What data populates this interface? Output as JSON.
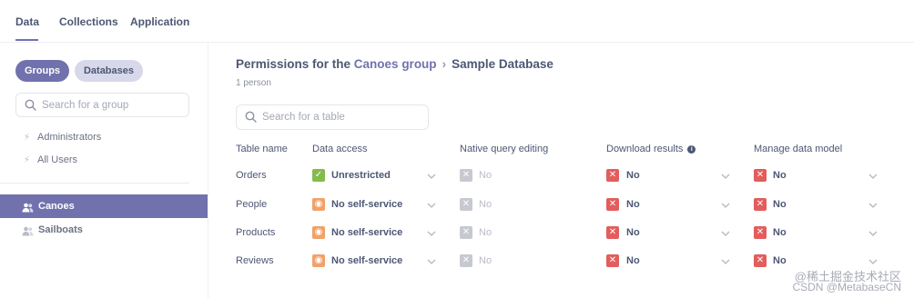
{
  "nav": {
    "tabs": [
      "Data",
      "Collections",
      "Application"
    ]
  },
  "sidebar": {
    "toggle": {
      "groups": "Groups",
      "databases": "Databases"
    },
    "search_placeholder": "Search for a group",
    "default_groups": [
      "Administrators",
      "All Users"
    ],
    "groups": [
      {
        "label": "Canoes",
        "active": true
      },
      {
        "label": "Sailboats",
        "active": false
      }
    ]
  },
  "main": {
    "title_prefix": "Permissions for the ",
    "group_name": "Canoes group",
    "database_name": "Sample Database",
    "subtitle": "1 person",
    "search_placeholder": "Search for a table",
    "columns": [
      "Table name",
      "Data access",
      "Native query editing",
      "Download results",
      "Manage data model"
    ],
    "rows": [
      {
        "table": "Orders",
        "data_access": "Unrestricted",
        "data_access_kind": "check",
        "native": "No",
        "download": "No",
        "model": "No"
      },
      {
        "table": "People",
        "data_access": "No self-service",
        "data_access_kind": "eye",
        "native": "No",
        "download": "No",
        "model": "No"
      },
      {
        "table": "Products",
        "data_access": "No self-service",
        "data_access_kind": "eye",
        "native": "No",
        "download": "No",
        "model": "No"
      },
      {
        "table": "Reviews",
        "data_access": "No self-service",
        "data_access_kind": "eye",
        "native": "No",
        "download": "No",
        "model": "No"
      }
    ]
  },
  "watermark": {
    "line1": "@稀土掘金技术社区",
    "line2": "CSDN @MetabaseCN"
  },
  "colors": {
    "accent": "#7172ad",
    "green": "#84bb4c",
    "orange": "#f0a26a",
    "red": "#e35d5d",
    "gray": "#c6c9d0"
  }
}
